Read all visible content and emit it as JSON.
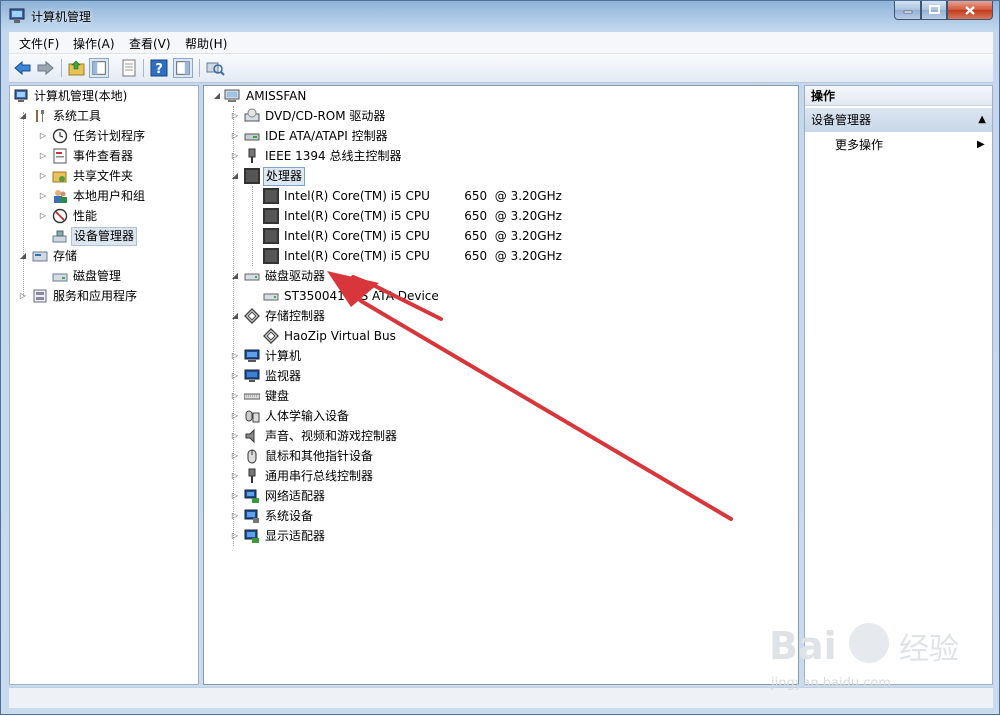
{
  "window": {
    "title": "计算机管理",
    "caption_buttons": [
      "min",
      "max",
      "close"
    ]
  },
  "menu": [
    "文件(F)",
    "操作(A)",
    "查看(V)",
    "帮助(H)"
  ],
  "toolbar_icons": [
    "back-icon",
    "forward-icon",
    "up-folder-icon",
    "show-hide-tree-icon",
    "properties-icon",
    "help-icon",
    "show-action-pane-icon",
    "scan-hardware-icon"
  ],
  "left_tree": {
    "root": "计算机管理(本地)",
    "system_tools": "系统工具",
    "task_scheduler": "任务计划程序",
    "event_viewer": "事件查看器",
    "shared_folders": "共享文件夹",
    "local_users": "本地用户和组",
    "performance": "性能",
    "device_manager": "设备管理器",
    "storage": "存储",
    "disk_management": "磁盘管理",
    "services_apps": "服务和应用程序"
  },
  "device_tree": {
    "computer_name": "AMISSFAN",
    "dvd": "DVD/CD-ROM 驱动器",
    "ide": "IDE ATA/ATAPI 控制器",
    "ieee": "IEEE 1394 总线主控制器",
    "processors": "处理器",
    "cpus": [
      "Intel(R) Core(TM) i5 CPU         650  @ 3.20GHz",
      "Intel(R) Core(TM) i5 CPU         650  @ 3.20GHz",
      "Intel(R) Core(TM) i5 CPU         650  @ 3.20GHz",
      "Intel(R) Core(TM) i5 CPU         650  @ 3.20GHz"
    ],
    "disk_drives": "磁盘驱动器",
    "disk_device": "ST3500418AS ATA Device",
    "storage_controllers": "存储控制器",
    "haozip": "HaoZip Virtual Bus",
    "computer": "计算机",
    "monitors": "监视器",
    "keyboards": "键盘",
    "hid": "人体学输入设备",
    "sound": "声音、视频和游戏控制器",
    "mice": "鼠标和其他指针设备",
    "usb": "通用串行总线控制器",
    "network": "网络适配器",
    "system_devices": "系统设备",
    "display": "显示适配器"
  },
  "actions": {
    "header": "操作",
    "section": "设备管理器",
    "more": "更多操作"
  },
  "watermark": "Bai 经验 jingyan.baidu.com",
  "colors": {
    "annotation_arrow": "#d8363a"
  }
}
